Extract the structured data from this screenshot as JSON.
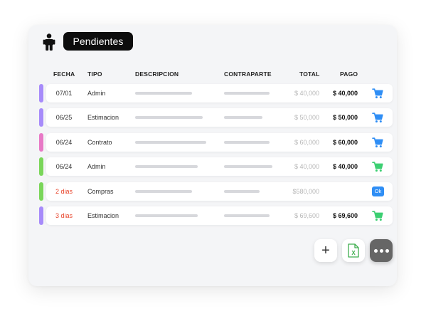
{
  "header": {
    "title": "Pendientes",
    "icon": "person-icon"
  },
  "columns": {
    "fecha": "FECHA",
    "tipo": "TIPO",
    "descripcion": "DESCRIPCION",
    "contraparte": "CONTRAPARTE",
    "total": "TOTAL",
    "pago": "PAGO"
  },
  "rows": [
    {
      "stripe": "#a78bfa",
      "fecha": "07/01",
      "fecha_red": false,
      "tipo": "Admin",
      "total": "$ 40,000",
      "pago": "$ 40,000",
      "action": "cart",
      "action_color": "#2f8ef5"
    },
    {
      "stripe": "#a78bfa",
      "fecha": "06/25",
      "fecha_red": false,
      "tipo": "Estimacion",
      "total": "$ 50,000",
      "pago": "$ 50,000",
      "action": "cart",
      "action_color": "#2f8ef5"
    },
    {
      "stripe": "#e879c6",
      "fecha": "06/24",
      "fecha_red": false,
      "tipo": "Contrato",
      "total": "$ 60,000",
      "pago": "$ 60,000",
      "action": "cart",
      "action_color": "#2f8ef5"
    },
    {
      "stripe": "#7ad65a",
      "fecha": "06/24",
      "fecha_red": false,
      "tipo": "Admin",
      "total": "$ 40,000",
      "pago": "$ 40,000",
      "action": "cart",
      "action_color": "#3ccf72"
    },
    {
      "stripe": "#7ad65a",
      "fecha": "2 dias",
      "fecha_red": true,
      "tipo": "Compras",
      "total": "$580,000",
      "pago": "",
      "action": "ok",
      "action_label": "Ok",
      "action_color": "#2f8ef5"
    },
    {
      "stripe": "#a78bfa",
      "fecha": "3 dias",
      "fecha_red": true,
      "tipo": "Estimacion",
      "total": "$ 69,600",
      "pago": "$ 69,600",
      "action": "cart",
      "action_color": "#3ccf72"
    }
  ],
  "actions": {
    "add_icon": "plus-icon",
    "excel_icon": "excel-icon",
    "excel_letter": "X",
    "more_icon": "more-icon"
  }
}
